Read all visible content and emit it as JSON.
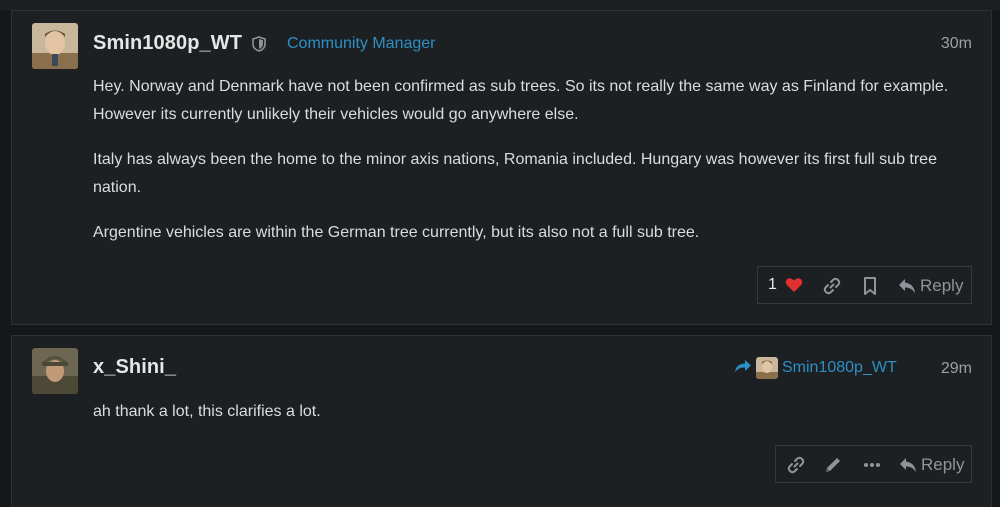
{
  "posts": [
    {
      "username": "Smin1080p_WT",
      "user_title": "Community Manager",
      "time": "30m",
      "paragraphs": [
        "Hey. Norway and Denmark have not been confirmed as sub trees. So its not really the same way as Finland for example. However its currently unlikely their vehicles would go anywhere else.",
        "Italy has always been the home to the minor axis nations, Romania included. Hungary was however its first full sub tree nation.",
        "Argentine vehicles are within the German tree currently, but its also not a full sub tree."
      ],
      "likes": "1",
      "reply_label": "Reply",
      "icons": [
        "shield-icon",
        "heart-icon",
        "link-icon",
        "bookmark-icon",
        "reply-icon"
      ]
    },
    {
      "username": "x_Shini_",
      "reply_to": "Smin1080p_WT",
      "time": "29m",
      "paragraphs": [
        "ah thank a lot, this clarifies a lot."
      ],
      "reply_label": "Reply",
      "icons": [
        "share-arrow-icon",
        "link-icon",
        "pencil-icon",
        "more-icon",
        "reply-icon"
      ]
    }
  ],
  "colors": {
    "background": "#15181a",
    "post_background": "#1c2023",
    "accent": "#2d8fc4",
    "heart": "#e03030",
    "muted": "#8e9499"
  }
}
